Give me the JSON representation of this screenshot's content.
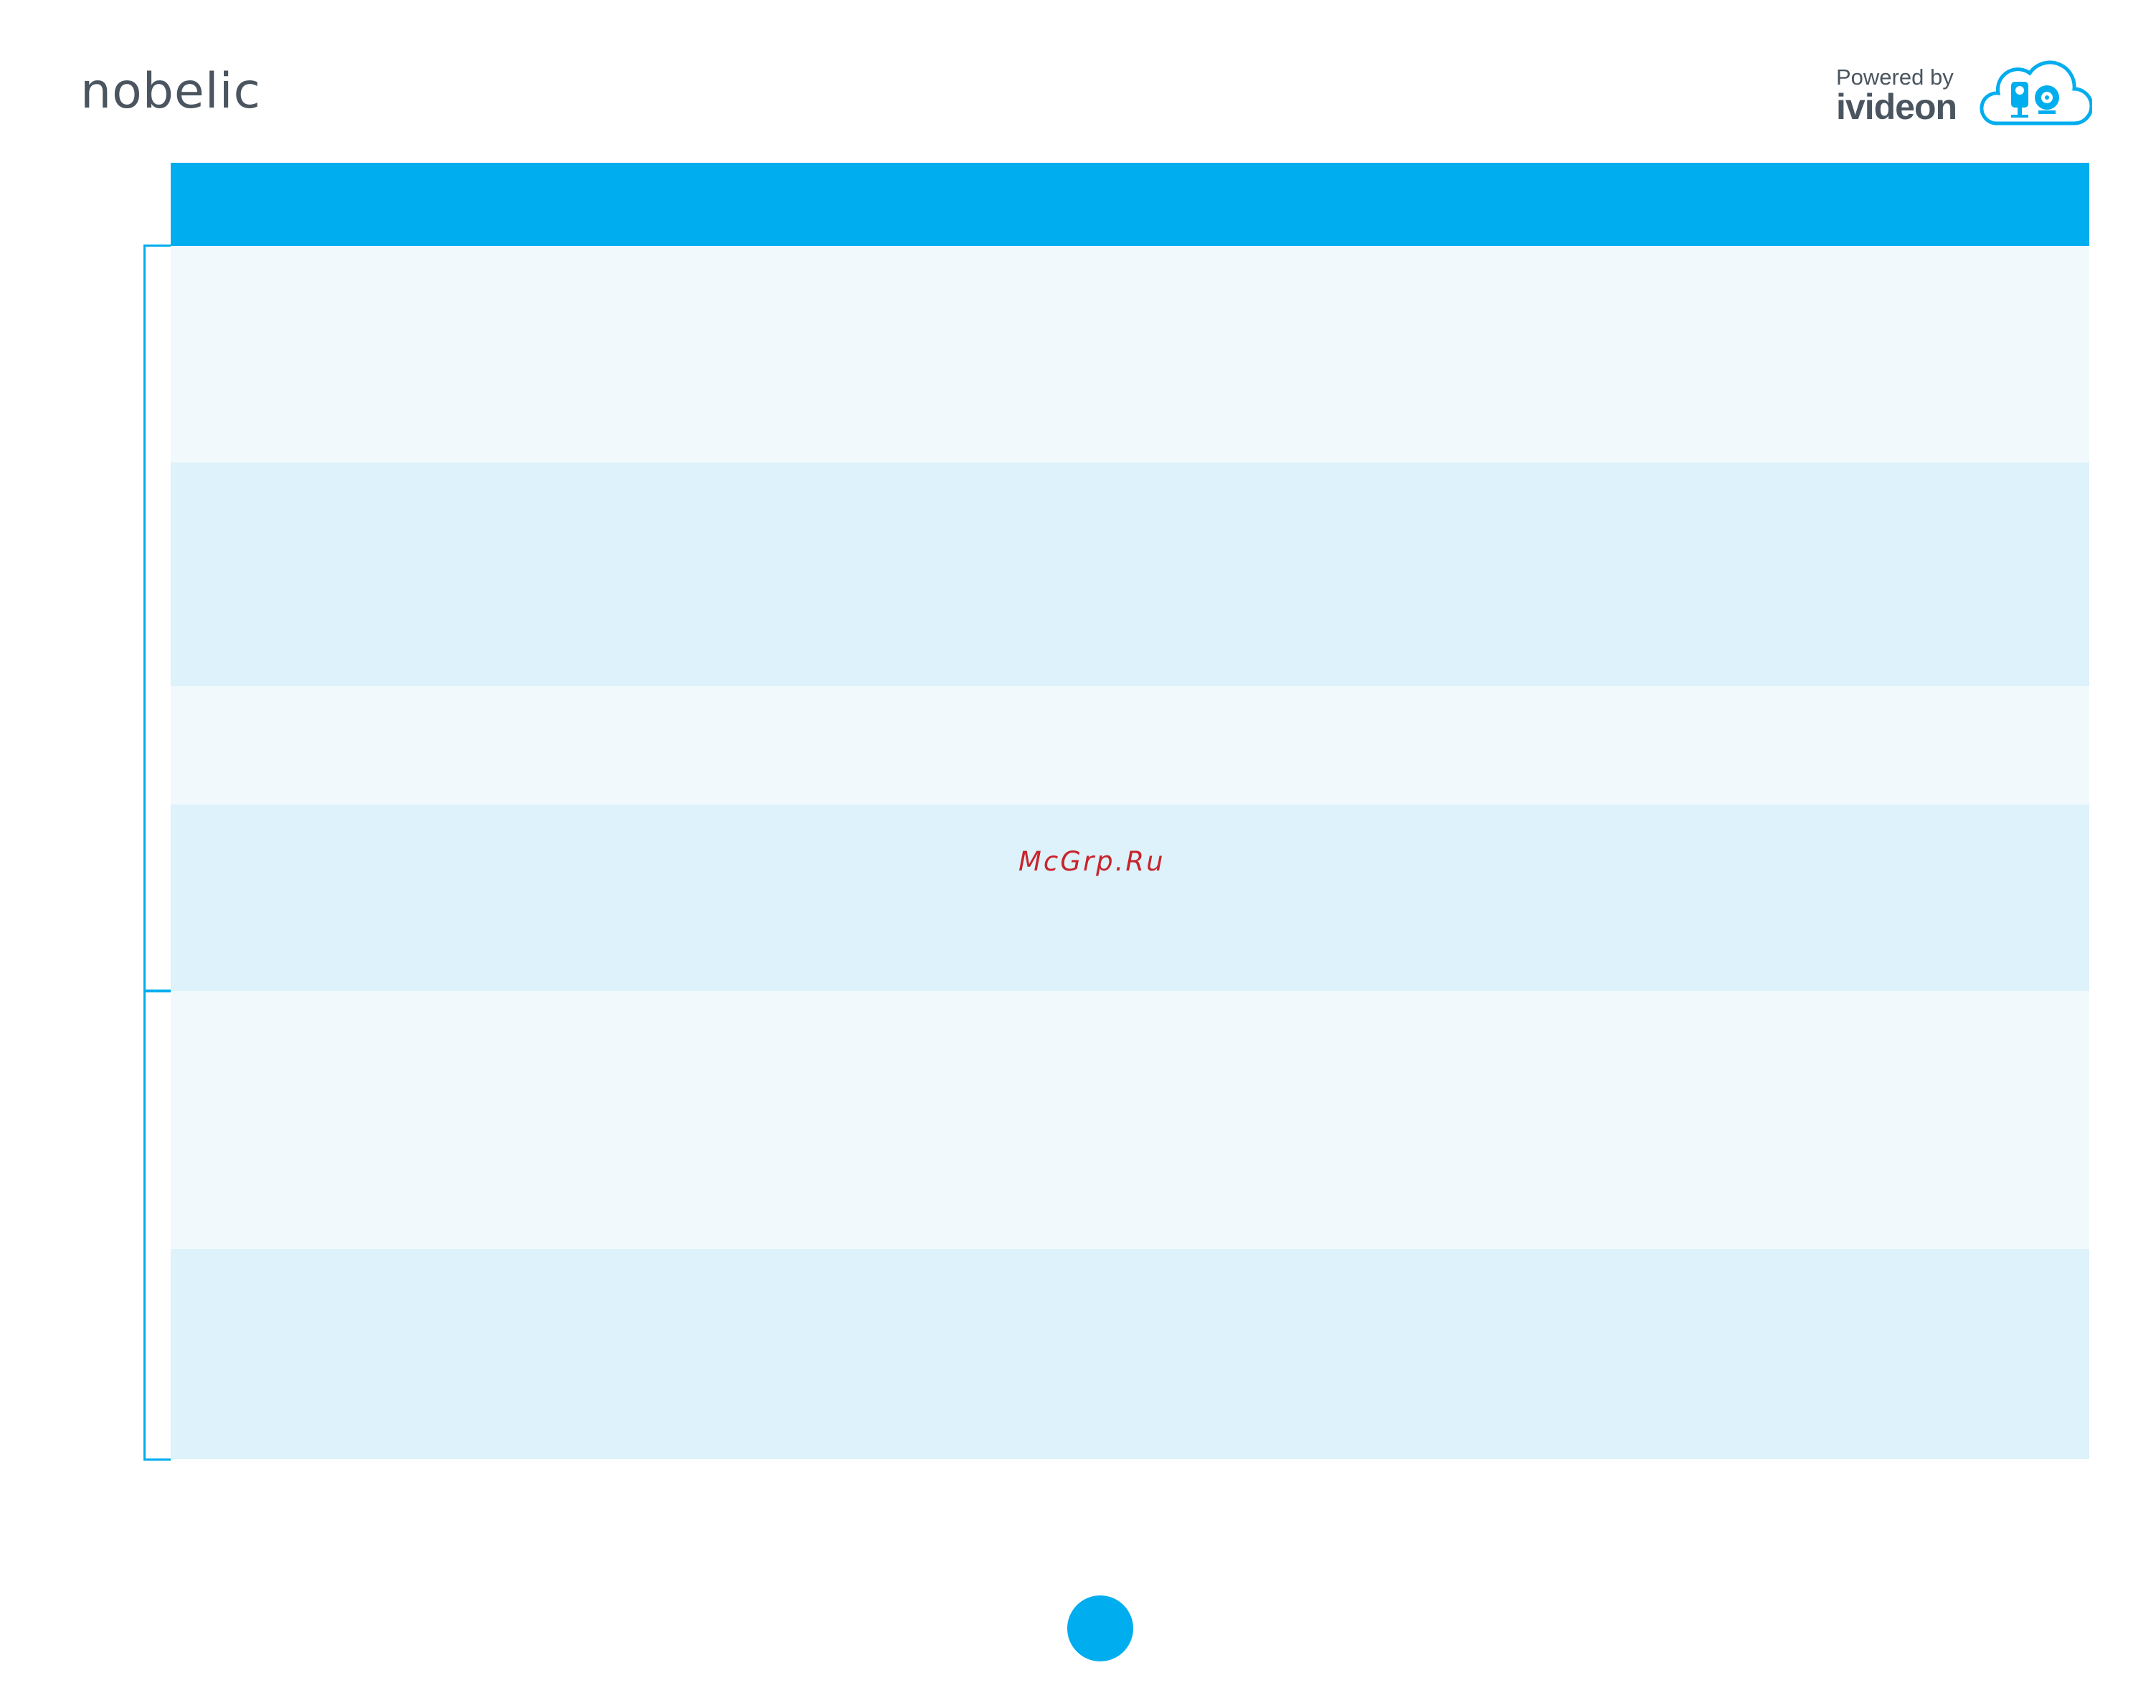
{
  "header": {
    "logo_text": "nobelic",
    "powered_by": "Powered by",
    "partner_logo_text": "ivideon",
    "partner_icon": "cloud-camera-icon"
  },
  "table": {
    "header_color": "#00adee",
    "row_colors": [
      "#f1f9fc",
      "#ddf2fa"
    ]
  },
  "watermark": {
    "text": "McGrp.Ru",
    "color": "#c8242c"
  },
  "page_marker_color": "#00adee"
}
